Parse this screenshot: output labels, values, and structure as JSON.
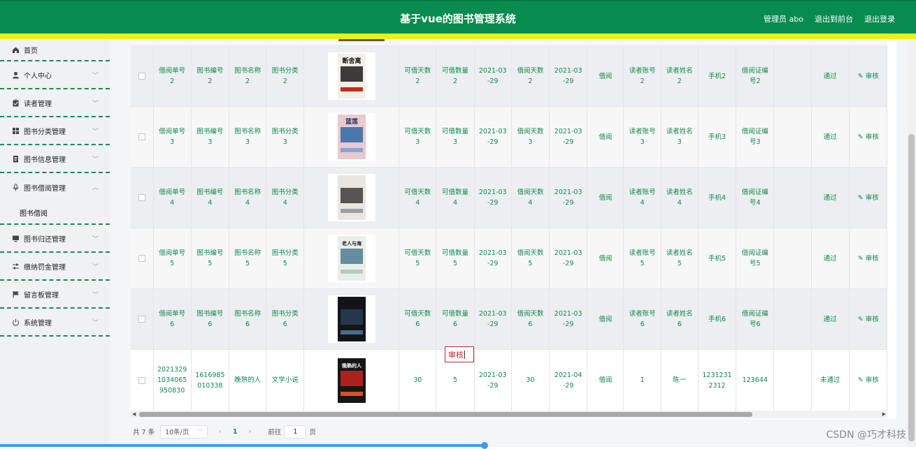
{
  "header": {
    "title": "基于vue的图书管理系统",
    "admin": "管理员 abo",
    "back_to_front": "退出到前台",
    "logout": "退出登录",
    "colors": {
      "primary": "#078b4e",
      "accent_bar": "#e8f11c"
    }
  },
  "sidebar": {
    "items": [
      {
        "label": "首页",
        "icon": "home-icon"
      },
      {
        "label": "个人中心",
        "icon": "user-icon"
      },
      {
        "label": "读者管理",
        "icon": "clipboard-icon"
      },
      {
        "label": "图书分类管理",
        "icon": "grid-icon"
      },
      {
        "label": "图书信息管理",
        "icon": "document-icon"
      },
      {
        "label": "图书借阅管理",
        "icon": "mic-icon"
      },
      {
        "label": "图书归还管理",
        "icon": "monitor-icon"
      },
      {
        "label": "缴纳罚金管理",
        "icon": "sliders-icon"
      },
      {
        "label": "留言板管理",
        "icon": "flag-icon"
      },
      {
        "label": "系统管理",
        "icon": "power-icon"
      }
    ],
    "submenu_label": "图书借阅"
  },
  "table": {
    "rows": [
      {
        "order": "借阅单号\n2",
        "book_no": "图书编号\n2",
        "book_name": "图书名称\n2",
        "category": "图书分类\n2",
        "cover_title": "断舍离",
        "avail_days": "可借天数\n2",
        "avail_qty": "可借数量\n2",
        "borrow_date": "2021-03\n-29",
        "borrow_days": "借阅天数\n2",
        "return_date": "2021-03\n-29",
        "type": "借阅",
        "reader_acct": "读者账号\n2",
        "reader_name": "读者姓名\n2",
        "phone": "手机2",
        "card_no": "借阅证编\n号2",
        "status": "通过",
        "action": "审核"
      },
      {
        "order": "借阅单号\n3",
        "book_no": "图书编号\n3",
        "book_name": "图书名称\n3",
        "category": "图书分类\n3",
        "cover_title": "蓝莲",
        "avail_days": "可借天数\n3",
        "avail_qty": "可借数量\n3",
        "borrow_date": "2021-03\n-29",
        "borrow_days": "借阅天数\n3",
        "return_date": "2021-03\n-29",
        "type": "借阅",
        "reader_acct": "读者账号\n3",
        "reader_name": "读者姓名\n3",
        "phone": "手机3",
        "card_no": "借阅证编\n号3",
        "status": "通过",
        "action": "审核"
      },
      {
        "order": "借阅单号\n4",
        "book_no": "图书编号\n4",
        "book_name": "图书名称\n4",
        "category": "图书分类\n4",
        "cover_title": "",
        "avail_days": "可借天数\n4",
        "avail_qty": "可借数量\n4",
        "borrow_date": "2021-03\n-29",
        "borrow_days": "借阅天数\n4",
        "return_date": "2021-03\n-29",
        "type": "借阅",
        "reader_acct": "读者账号\n4",
        "reader_name": "读者姓名\n4",
        "phone": "手机4",
        "card_no": "借阅证编\n号4",
        "status": "通过",
        "action": "审核"
      },
      {
        "order": "借阅单号\n5",
        "book_no": "图书编号\n5",
        "book_name": "图书名称\n5",
        "category": "图书分类\n5",
        "cover_title": "老人与海",
        "avail_days": "可借天数\n5",
        "avail_qty": "可借数量\n5",
        "borrow_date": "2021-03\n-29",
        "borrow_days": "借阅天数\n5",
        "return_date": "2021-03\n-29",
        "type": "借阅",
        "reader_acct": "读者账号\n5",
        "reader_name": "读者姓名\n5",
        "phone": "手机5",
        "card_no": "借阅证编\n号5",
        "status": "通过",
        "action": "审核"
      },
      {
        "order": "借阅单号\n6",
        "book_no": "图书编号\n6",
        "book_name": "图书名称\n6",
        "category": "图书分类\n6",
        "cover_title": "",
        "avail_days": "可借天数\n6",
        "avail_qty": "可借数量\n6",
        "borrow_date": "2021-03\n-29",
        "borrow_days": "借阅天数\n6",
        "return_date": "2021-03\n-29",
        "type": "借阅",
        "reader_acct": "读者账号\n6",
        "reader_name": "读者姓名\n6",
        "phone": "手机6",
        "card_no": "借阅证编\n号6",
        "status": "通过",
        "action": "审核"
      },
      {
        "order": "2021329\n1034065\n950830",
        "book_no": "1616985\n010338",
        "book_name": "晚熟的人",
        "category": "文学小说",
        "cover_title": "晚熟的人",
        "avail_days": "30",
        "avail_qty": "5",
        "borrow_date": "2021-03\n-29",
        "borrow_days": "30",
        "return_date": "2021-04\n-29",
        "type": "借阅",
        "reader_acct": "1",
        "reader_name": "陈一",
        "phone": "1231231\n2312",
        "card_no": "123644",
        "status": "未通过",
        "action": "审核"
      }
    ]
  },
  "edit_box": {
    "value": "审核"
  },
  "pager": {
    "total": "共 7 条",
    "page_size": "10条/页",
    "current_page": "1",
    "goto_label": "前往",
    "goto_value": "1",
    "page_unit": "页",
    "prev": "‹",
    "next": "›"
  },
  "watermark": "CSDN @巧才科技"
}
